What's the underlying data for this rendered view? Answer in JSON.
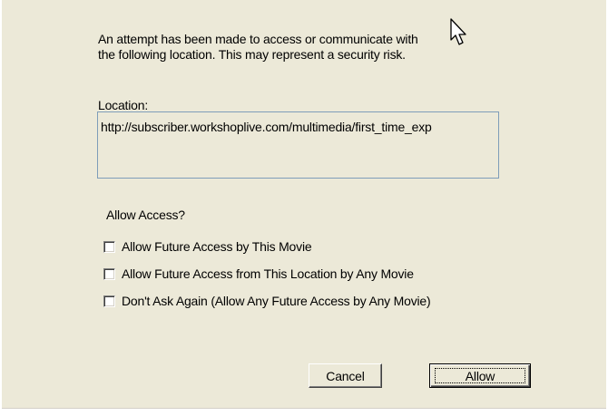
{
  "dialog": {
    "message_line1": "An attempt has been made to access or communicate with",
    "message_line2": "the following location. This may represent a security risk.",
    "location_label": "Location:",
    "location_url": "http://subscriber.workshoplive.com/multimedia/first_time_exp",
    "allow_access_label": "Allow Access?",
    "options": [
      {
        "label": "Allow Future Access by This Movie",
        "checked": false
      },
      {
        "label": "Allow Future Access from This Location by Any Movie",
        "checked": false
      },
      {
        "label": "Don't Ask Again (Allow Any Future Access by Any Movie)",
        "checked": false
      }
    ],
    "buttons": {
      "cancel_label": "Cancel",
      "allow_label": "Allow"
    }
  },
  "icons": {
    "cursor": "mouse-pointer-icon"
  },
  "colors": {
    "dialog_background": "#ece9d8",
    "url_box_border": "#7f9db9"
  }
}
